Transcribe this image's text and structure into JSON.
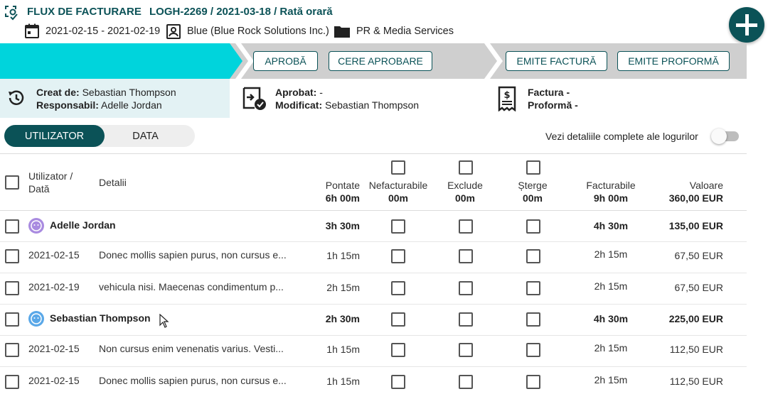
{
  "header": {
    "title": "FLUX DE FACTURARE",
    "subtitle": "LOGH-2269 / 2021-03-18 / Rată orară",
    "date_range": "2021-02-15 - 2021-02-19",
    "client": "Blue (Blue Rock Solutions Inc.)",
    "project": "PR & Media Services"
  },
  "workflow": {
    "approve": "APROBĂ",
    "request_approval": "CERE APROBARE",
    "issue_invoice": "EMITE FACTURĂ",
    "issue_proforma": "EMITE PROFORMĂ"
  },
  "info": {
    "created_label": "Creat de:",
    "created_value": "Sebastian Thompson",
    "responsible_label": "Responsabil:",
    "responsible_value": "Adelle Jordan",
    "approved_label": "Aprobat:",
    "approved_value": "-",
    "modified_label": "Modificat:",
    "modified_value": "Sebastian Thompson",
    "invoice_label": "Factura",
    "invoice_value": "-",
    "proforma_label": "Proformă",
    "proforma_value": "-"
  },
  "view_toggle": {
    "user": "UTILIZATOR",
    "date": "DATA"
  },
  "details_switch_label": "Vezi detaliile complete ale logurilor",
  "table": {
    "col_user": "Utilizator /",
    "col_user2": "Dată",
    "col_details": "Detalii",
    "col_logged": "Pontate",
    "col_logged_total": "6h 00m",
    "col_nonbillable": "Nefacturabile",
    "col_nonbillable_total": "00m",
    "col_exclude": "Exclude",
    "col_exclude_total": "00m",
    "col_delete": "Șterge",
    "col_delete_total": "00m",
    "col_billable": "Facturabile",
    "col_billable_total": "9h 00m",
    "col_value": "Valoare",
    "col_value_total": "360,00 EUR",
    "rows": [
      {
        "type": "user",
        "label": "Adelle Jordan",
        "logged": "3h 30m",
        "billable": "4h 30m",
        "value": "135,00 EUR"
      },
      {
        "type": "entry",
        "date": "2021-02-15",
        "details": "Donec mollis sapien purus, non cursus e...",
        "logged": "1h 15m",
        "billable": "2h 15m",
        "value": "67,50 EUR"
      },
      {
        "type": "entry",
        "date": "2021-02-19",
        "details": "vehicula nisi. Maecenas condimentum p...",
        "logged": "2h 15m",
        "billable": "2h 15m",
        "value": "67,50 EUR"
      },
      {
        "type": "user",
        "label": "Sebastian Thompson",
        "logged": "2h 30m",
        "billable": "4h 30m",
        "value": "225,00 EUR"
      },
      {
        "type": "entry",
        "date": "2021-02-15",
        "details": "Non cursus enim venenatis varius. Vesti...",
        "logged": "1h 15m",
        "billable": "2h 15m",
        "value": "112,50 EUR"
      },
      {
        "type": "entry",
        "date": "2021-02-15",
        "details": "Donec mollis sapien purus, non cursus e...",
        "logged": "1h 15m",
        "billable": "2h 15m",
        "value": "112,50 EUR"
      }
    ]
  },
  "colors": {
    "brand": "#0b5257",
    "progress": "#00d4dc",
    "band_grey": "#cfcfcf",
    "info_bg": "#e3f2f4"
  },
  "icons": [
    "workflow-icon",
    "calendar-icon",
    "contact-card-icon",
    "folder-icon",
    "add-icon",
    "history-icon",
    "approve-doc-icon",
    "receipt-icon",
    "cursor-icon"
  ]
}
